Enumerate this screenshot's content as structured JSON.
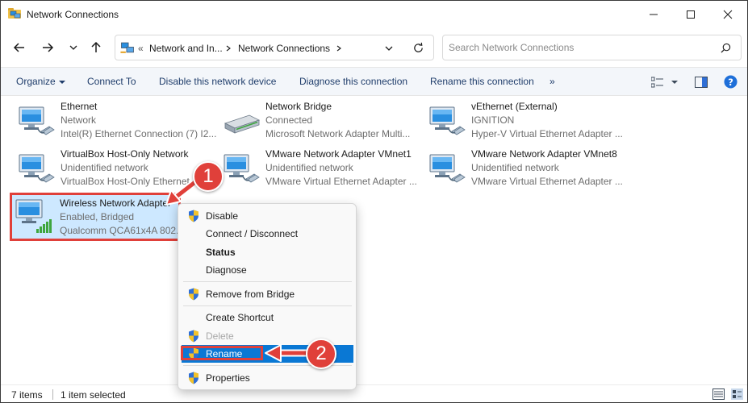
{
  "window": {
    "title": "Network Connections"
  },
  "address": {
    "overflow": "«",
    "crumbs": [
      "Network and In...",
      "Network Connections"
    ],
    "search_placeholder": "Search Network Connections"
  },
  "toolbar": {
    "organize": "Organize",
    "connect_to": "Connect To",
    "disable": "Disable this network device",
    "diagnose": "Diagnose this connection",
    "rename": "Rename this connection",
    "more": "»"
  },
  "items": [
    {
      "name": "Ethernet",
      "status": "Network",
      "device": "Intel(R) Ethernet Connection (7) I2..."
    },
    {
      "name": "Network Bridge",
      "status": "Connected",
      "device": "Microsoft Network Adapter Multi..."
    },
    {
      "name": "vEthernet (External)",
      "status": "IGNITION",
      "device": "Hyper-V Virtual Ethernet Adapter ..."
    },
    {
      "name": "VirtualBox Host-Only Network",
      "status": "Unidentified network",
      "device": "VirtualBox Host-Only Ethernet ..."
    },
    {
      "name": "VMware Network Adapter VMnet1",
      "status": "Unidentified network",
      "device": "VMware Virtual Ethernet Adapter ..."
    },
    {
      "name": "VMware Network Adapter VMnet8",
      "status": "Unidentified network",
      "device": "VMware Virtual Ethernet Adapter ..."
    },
    {
      "name": "Wireless Network Adapter",
      "status": "Enabled, Bridged",
      "device": "Qualcomm QCA61x4A 802.1..."
    }
  ],
  "context_menu": {
    "disable": "Disable",
    "connect": "Connect / Disconnect",
    "status": "Status",
    "diagnose": "Diagnose",
    "remove_bridge": "Remove from Bridge",
    "create_shortcut": "Create Shortcut",
    "delete": "Delete",
    "rename": "Rename",
    "properties": "Properties"
  },
  "annotations": {
    "step1": "1",
    "step2": "2",
    "color": "#e0403a"
  },
  "statusbar": {
    "count": "7 items",
    "selected": "1 item selected"
  },
  "colors": {
    "accent": "#0a78d4",
    "selection": "#cde8ff",
    "toolbar_bg": "#f3f6fa"
  }
}
